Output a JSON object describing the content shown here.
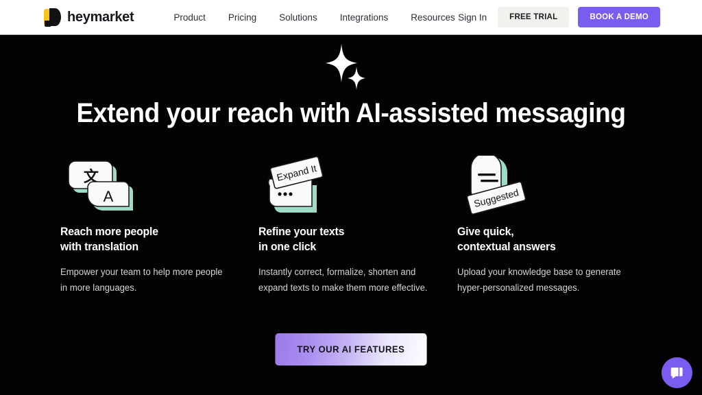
{
  "header": {
    "brand": {
      "name": "heymarket",
      "mark_icon": "heymarket-logo-icon"
    },
    "nav": [
      {
        "label": "Product"
      },
      {
        "label": "Pricing"
      },
      {
        "label": "Solutions"
      },
      {
        "label": "Integrations"
      },
      {
        "label": "Resources"
      }
    ],
    "sign_in_label": "Sign In",
    "free_trial_label": "FREE TRIAL",
    "book_demo_label": "BOOK A DEMO",
    "colors": {
      "background": "#ffffff",
      "text": "#2b2f36",
      "free_trial_bg": "#f3f1ee",
      "book_demo_bg": "#7b5cf0"
    }
  },
  "hero": {
    "headline": "Extend your reach with AI-assisted messaging",
    "sparkle_icon": "sparkle-icon",
    "background": "#030303",
    "cta_label": "TRY OUR AI FEATURES",
    "cta_gradient_start": "#9b7ae8",
    "cta_gradient_end": "#fdfdff"
  },
  "features": [
    {
      "icon": "translate-bubbles-icon",
      "icon_glyphs": [
        "文",
        "A"
      ],
      "title": "Reach more people\nwith translation",
      "body": "Empower your team to help more people in more languages."
    },
    {
      "icon": "expand-it-card-icon",
      "icon_label": "Expand It",
      "icon_glyphs": [
        "•••"
      ],
      "title": "Refine your texts\nin one click",
      "body": "Instantly correct, formalize, shorten and expand texts to make them more effective."
    },
    {
      "icon": "suggested-reply-icon",
      "icon_label": "Suggested",
      "title": "Give quick,\ncontextual answers",
      "body": "Upload your knowledge base to generate hyper-personalized messages."
    }
  ],
  "chat_widget": {
    "icon": "chat-bubble-icon",
    "color": "#7b5cf0"
  },
  "theme": {
    "accent_purple": "#7b5cf0",
    "brand_yellow": "#f5c518",
    "icon_mint": "#9fdcc5",
    "page_black": "#030303"
  }
}
